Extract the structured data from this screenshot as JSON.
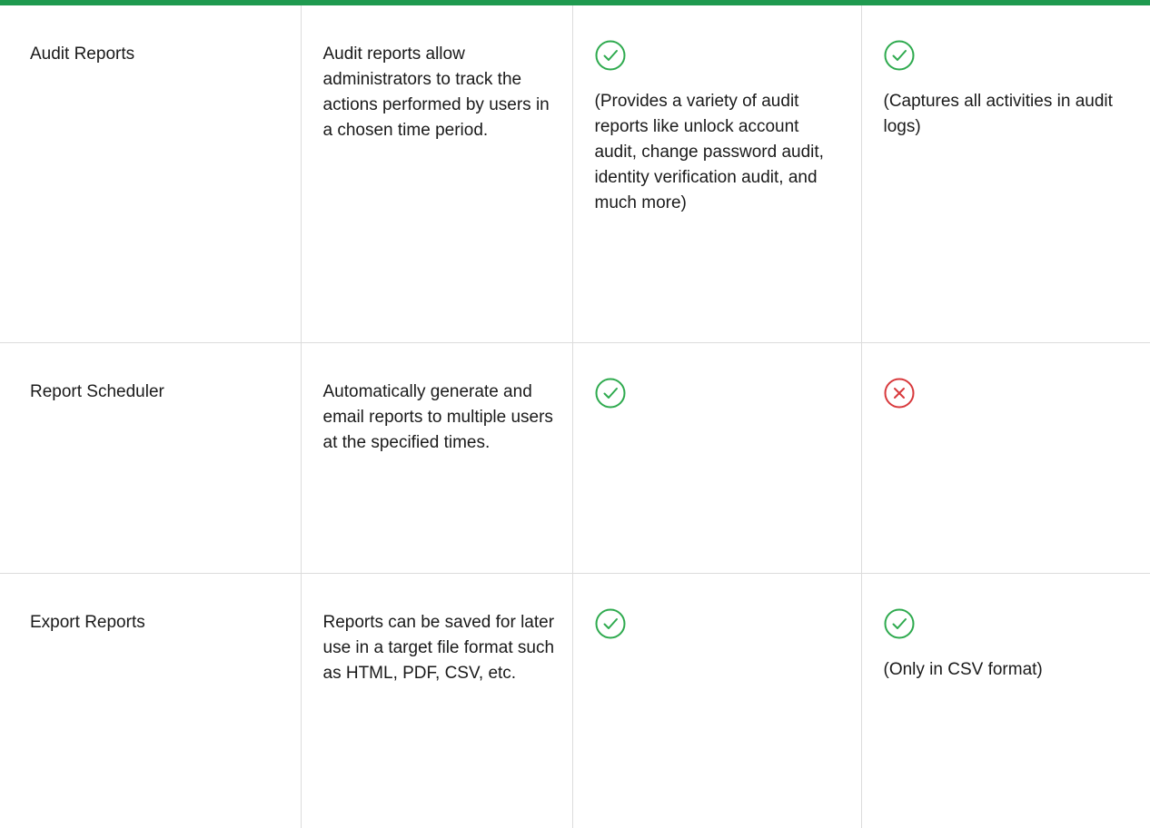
{
  "colors": {
    "top_bar": "#1f9a4f",
    "check": "#2eaa4e",
    "cross": "#d8393c",
    "grid": "#dcdcdc"
  },
  "rows": [
    {
      "feature": "Audit Reports",
      "description": "Audit reports allow administrators to track the actions performed by users in a chosen time period.",
      "col3": {
        "icon": "check-circle-icon",
        "note": "(Provides a variety of audit reports like unlock account audit, change password audit, identity verification audit, and much more)"
      },
      "col4": {
        "icon": "check-circle-icon",
        "note": "(Captures all activities in audit logs)"
      }
    },
    {
      "feature": "Report Scheduler",
      "description": "Automatically generate and email reports to multiple users at the specified times.",
      "col3": {
        "icon": "check-circle-icon",
        "note": ""
      },
      "col4": {
        "icon": "cross-circle-icon",
        "note": ""
      }
    },
    {
      "feature": "Export Reports",
      "description": "Reports can be saved for later use in a target file format such as HTML, PDF, CSV, etc.",
      "col3": {
        "icon": "check-circle-icon",
        "note": ""
      },
      "col4": {
        "icon": "check-circle-icon",
        "note": "(Only in CSV format)"
      }
    }
  ]
}
